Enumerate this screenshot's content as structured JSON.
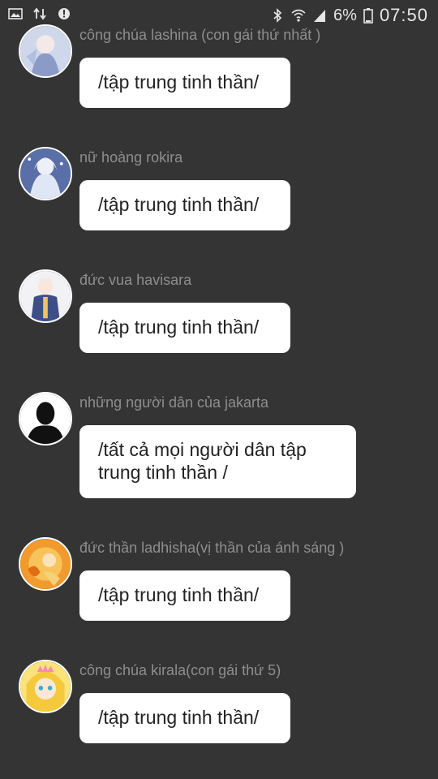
{
  "status_bar": {
    "battery_percent": "6%",
    "time": "07:50",
    "icons": [
      "image-icon",
      "data-transfer-icon",
      "shield-alert-icon",
      "bluetooth-icon",
      "wifi-icon",
      "signal-icon",
      "battery-icon"
    ]
  },
  "messages": [
    {
      "sender": "công chúa lashina (con gái thứ nhất )",
      "text": "/tập trung tinh thần/",
      "avatar": "avatar-lashina"
    },
    {
      "sender": "nữ hoàng rokira",
      "text": "/tập trung tinh thần/",
      "avatar": "avatar-rokira"
    },
    {
      "sender": "đức vua havisara",
      "text": "/tập trung tinh thần/",
      "avatar": "avatar-havisara"
    },
    {
      "sender": "những người dân của jakarta",
      "text": "/tất cả mọi người dân tập trung tinh thần /",
      "avatar": "avatar-silhouette"
    },
    {
      "sender": "đức thần ladhisha(vị thần của ánh sáng )",
      "text": "/tập trung tinh thần/",
      "avatar": "avatar-ladhisha"
    },
    {
      "sender": "công chúa kirala(con gái thứ 5)",
      "text": "/tập trung tinh thần/",
      "avatar": "avatar-kirala"
    }
  ]
}
